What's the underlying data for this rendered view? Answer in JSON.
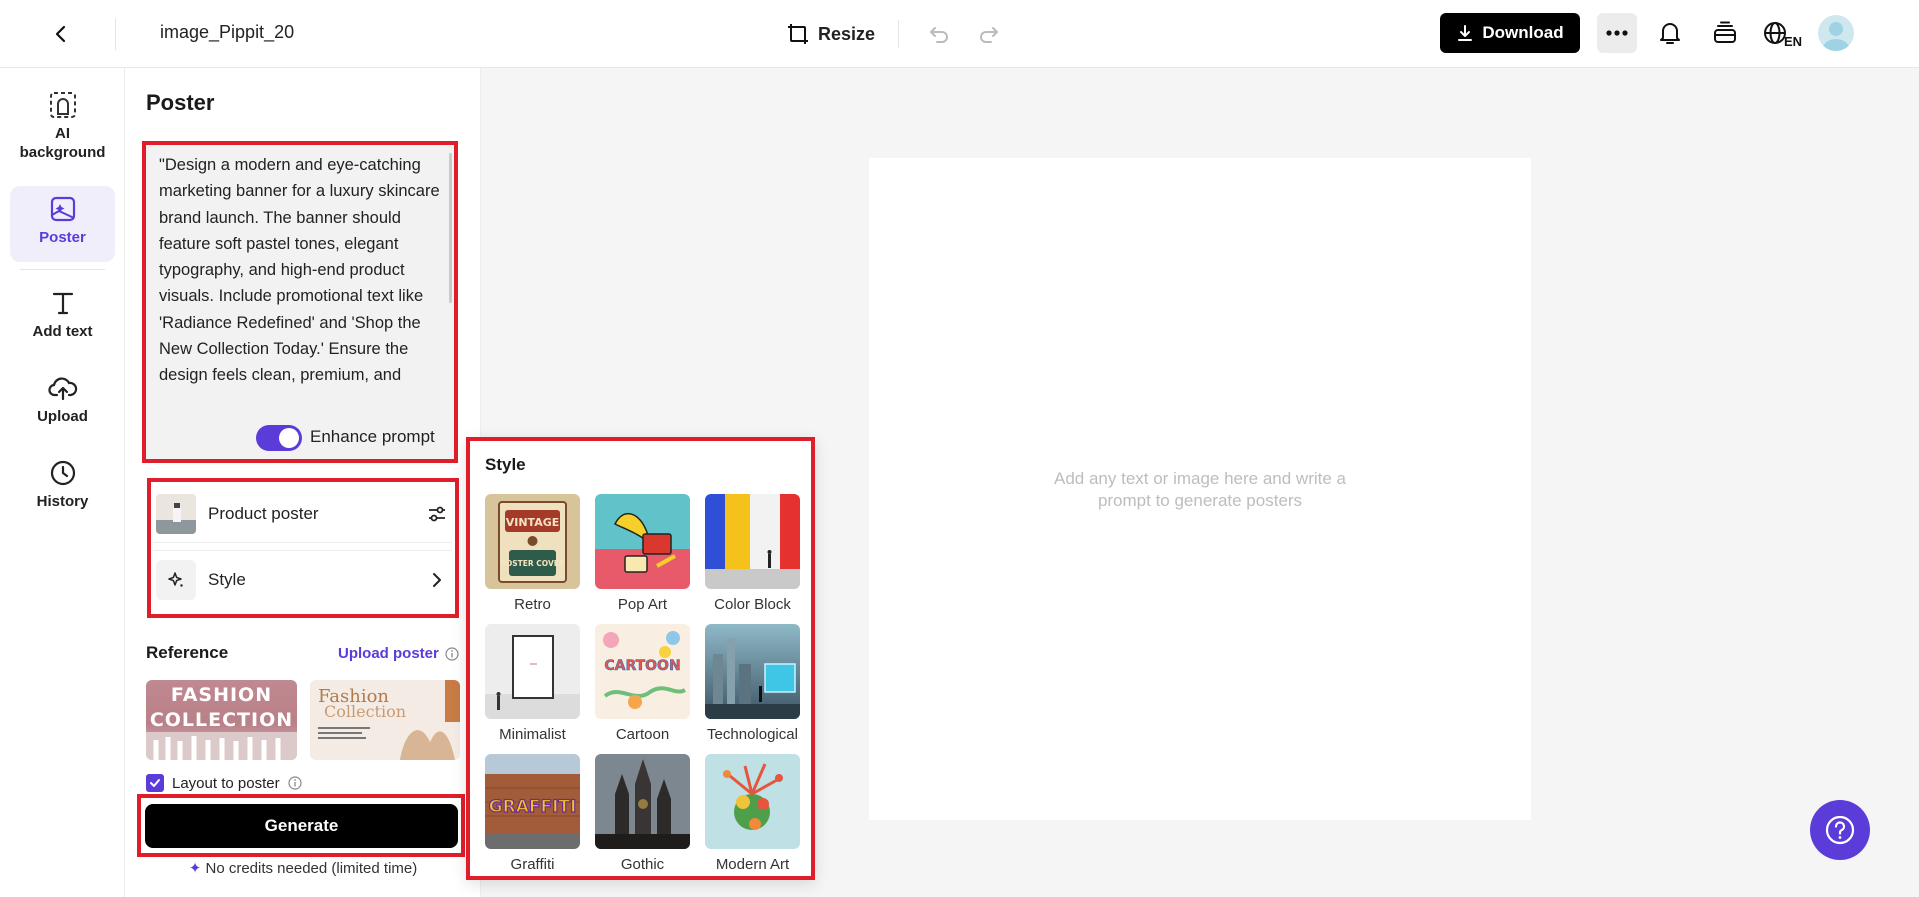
{
  "topbar": {
    "file_name": "image_Pippit_20",
    "resize_label": "Resize",
    "download_label": "Download",
    "lang_label": "EN"
  },
  "rail": {
    "items": [
      {
        "label_line1": "AI",
        "label_line2": "background",
        "icon": "ai-background-icon"
      },
      {
        "label": "Poster",
        "icon": "poster-icon",
        "active": true
      },
      {
        "label": "Add text",
        "icon": "text-icon"
      },
      {
        "label": "Upload",
        "icon": "upload-icon"
      },
      {
        "label": "History",
        "icon": "history-icon"
      }
    ]
  },
  "panel": {
    "title": "Poster",
    "prompt": "\"Design a modern and eye-catching marketing banner for a luxury skincare brand launch. The banner should feature soft pastel tones, elegant typography, and high-end product visuals. Include promotional text like 'Radiance Redefined' and 'Shop the New Collection Today.' Ensure the design feels clean, premium, and",
    "enhance_label": "Enhance prompt",
    "enhance_on": true,
    "product_poster_label": "Product poster",
    "style_label": "Style",
    "reference_title": "Reference",
    "upload_poster_label": "Upload poster",
    "ref1_line1": "FASHION",
    "ref1_line2": "COLLECTION",
    "ref2_line1": "Fashion",
    "ref2_line2": "Collection",
    "layout_label": "Layout to poster",
    "layout_checked": true,
    "generate_label": "Generate",
    "credits_label": "No credits needed (limited time)"
  },
  "style_popup": {
    "title": "Style",
    "styles": [
      "Retro",
      "Pop Art",
      "Color Block",
      "Minimalist",
      "Cartoon",
      "Technological",
      "Graffiti",
      "Gothic",
      "Modern Art"
    ],
    "retro_t1": "VINTAGE",
    "retro_t2": "POSTER COVER",
    "cartoon_t": "CARTOON",
    "graffiti_t": "GRAFFITI"
  },
  "canvas": {
    "hint_line1": "Add any text or image here and write a",
    "hint_line2": "prompt to generate posters"
  },
  "colors": {
    "accent": "#5b3cd9",
    "highlight": "#e01e2b"
  }
}
